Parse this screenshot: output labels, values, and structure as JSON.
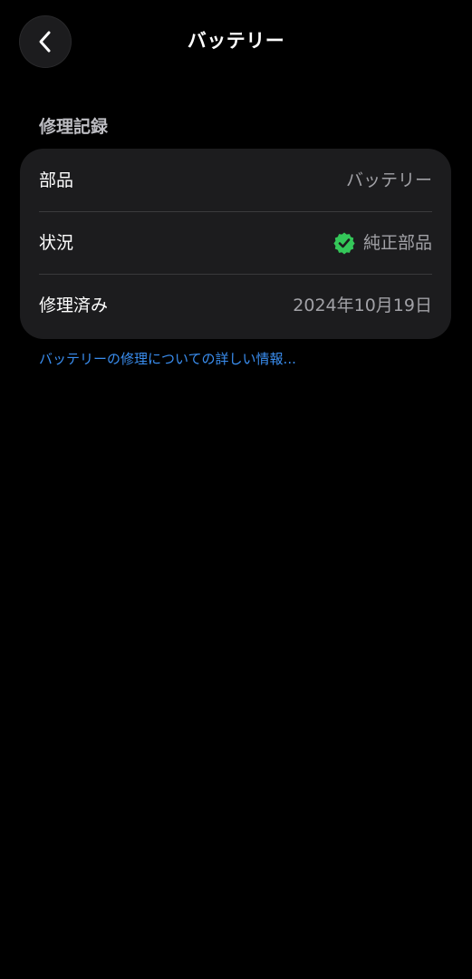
{
  "header": {
    "title": "バッテリー",
    "back_icon": "chevron-left-icon"
  },
  "section": {
    "title": "修理記録"
  },
  "rows": [
    {
      "label": "部品",
      "value": "バッテリー"
    },
    {
      "label": "状況",
      "value": "純正部品",
      "icon": "verified-badge-icon"
    },
    {
      "label": "修理済み",
      "value": "2024年10月19日"
    }
  ],
  "link": {
    "text": "バッテリーの修理についての詳しい情報..."
  },
  "colors": {
    "background": "#000000",
    "card": "#1c1c1e",
    "separator": "#3a3a3c",
    "link": "#3a8ef0",
    "verified": "#34c759",
    "secondary_text": "#a1a1a6"
  }
}
